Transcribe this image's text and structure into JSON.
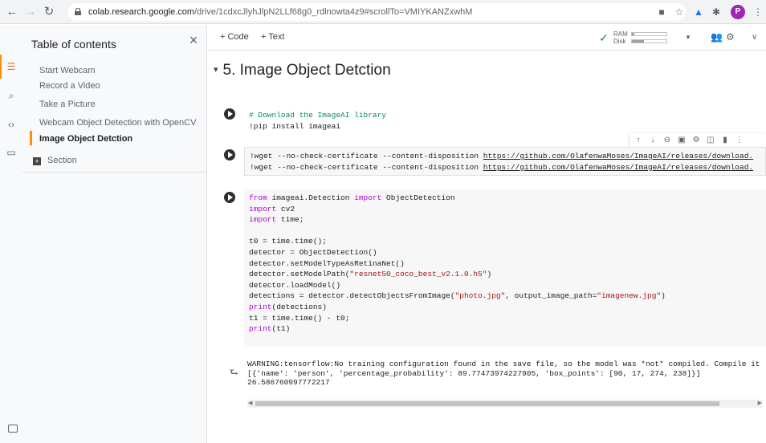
{
  "browser": {
    "url_host": "colab.research.google.com",
    "url_path": "/drive/1cdxcJlyhJlpN2LLf68g0_rdlnowta4z9#scrollTo=VMIYKANZxwhM",
    "profile_initial": "P"
  },
  "toc": {
    "title": "Table of contents",
    "items": [
      {
        "label": "Start Webcam"
      },
      {
        "label": "Record a Video"
      },
      {
        "label": "Take a Picture"
      },
      {
        "label": "Webcam Object Detection with OpenCV"
      },
      {
        "label": "Image Object Detction"
      }
    ],
    "section_label": "Section"
  },
  "toolbar": {
    "add_code": "+ Code",
    "add_text": "+ Text",
    "ram_label": "RAM",
    "disk_label": "Disk",
    "ram_fraction": 0.08,
    "disk_fraction": 0.35
  },
  "section_heading": "5. Image Object Detction",
  "cells": {
    "c1": {
      "line1": "# Download the ImageAI library",
      "line2": "!pip install imageai"
    },
    "c2": {
      "prefix1": "!wget --no-check-certificate --content-disposition ",
      "url1": "https://github.com/OlafenwaMoses/ImageAI/releases/download.",
      "prefix2": "!wget --no-check-certificate --content-disposition ",
      "url2": "https://github.com/OlafenwaMoses/ImageAI/releases/download."
    },
    "c3": {
      "l1_kw1": "from",
      "l1_a": " imageai.Detection ",
      "l1_kw2": "import",
      "l1_b": " ObjectDetection",
      "l2_kw": "import",
      "l2_b": " cv2",
      "l3_kw": "import",
      "l3_b": " time;",
      "l5": "t0 = time.time();",
      "l6": "detector = ObjectDetection()",
      "l7": "detector.setModelTypeAsRetinaNet()",
      "l8_a": "detector.setModelPath(",
      "l8_s": "\"resnet50_coco_best_v2.1.0.h5\"",
      "l8_b": ")",
      "l9": "detector.loadModel()",
      "l10_a": "detections = detector.detectObjectsFromImage(",
      "l10_s1": "\"photo.jpg\"",
      "l10_b": ", output_image_path=",
      "l10_s2": "\"imagenew.jpg\"",
      "l10_c": ")",
      "l11_kw": "print",
      "l11_b": "(detections)",
      "l12": "t1 = time.time() - t0;",
      "l13_kw": "print",
      "l13_b": "(t1)"
    }
  },
  "output": {
    "line1": "WARNING:tensorflow:No training configuration found in the save file, so the model was *not* compiled. Compile it",
    "line2": "[{'name': 'person', 'percentage_probability': 89.77473974227905, 'box_points': [90, 17, 274, 238]}]",
    "line3": "26.586760997772217"
  }
}
